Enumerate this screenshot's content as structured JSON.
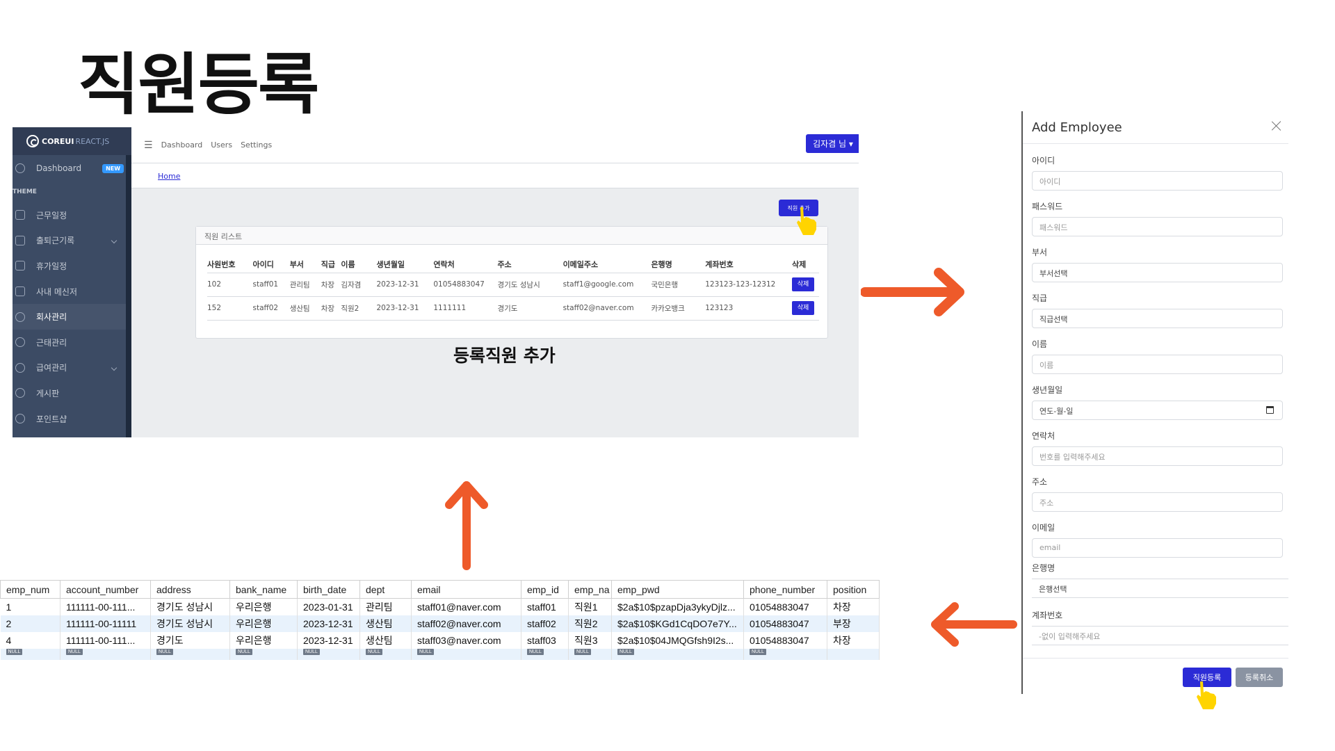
{
  "slide_title": "직원등록",
  "caption": "등록직원 추가",
  "sidebar": {
    "brand_name": "COREUI",
    "brand_suffix": "REACT.JS",
    "dashboard_label": "Dashboard",
    "dashboard_badge": "NEW",
    "section_title": "THEME",
    "items": [
      {
        "label": "근무일정"
      },
      {
        "label": "출퇴근기록"
      },
      {
        "label": "휴가일정"
      },
      {
        "label": "사내 메신저"
      },
      {
        "label": "회사관리"
      },
      {
        "label": "근태관리"
      },
      {
        "label": "급여관리"
      },
      {
        "label": "게시판"
      },
      {
        "label": "포인트샵"
      }
    ]
  },
  "header": {
    "links": [
      "Dashboard",
      "Users",
      "Settings"
    ],
    "user_button": "김자겸 님 ▾",
    "breadcrumb": "Home",
    "add_button": "직원 추가"
  },
  "employee_card": {
    "title": "직원 리스트",
    "columns": [
      "사원번호",
      "아이디",
      "부서",
      "직급",
      "이름",
      "생년월일",
      "연락처",
      "주소",
      "이메일주소",
      "은행명",
      "계좌번호",
      "삭제"
    ],
    "rows": [
      [
        "102",
        "staff01",
        "관리팀",
        "차장",
        "김자겸",
        "2023-12-31",
        "01054883047",
        "경기도 성남시",
        "staff1@google.com",
        "국민은행",
        "123123-123-12312"
      ],
      [
        "152",
        "staff02",
        "생산팀",
        "차장",
        "직원2",
        "2023-12-31",
        "1111111",
        "경기도",
        "staff02@naver.com",
        "카카오뱅크",
        "123123"
      ]
    ],
    "delete_label": "삭제"
  },
  "modal": {
    "title": "Add Employee",
    "fields": [
      {
        "label": "아이디",
        "placeholder": "아이디"
      },
      {
        "label": "패스워드",
        "placeholder": "패스워드"
      },
      {
        "label": "부서",
        "value": "부서선택"
      },
      {
        "label": "직급",
        "value": "직급선택"
      },
      {
        "label": "이름",
        "placeholder": "이름"
      },
      {
        "label": "생년월일",
        "value": "연도-월-일"
      },
      {
        "label": "연락처",
        "placeholder": "번호를 입력해주세요"
      },
      {
        "label": "주소",
        "placeholder": "주소"
      },
      {
        "label": "이메일",
        "placeholder": "email"
      },
      {
        "label": "은행명",
        "value": "은행선택"
      },
      {
        "label": "계좌번호",
        "placeholder": "-없이 입력해주세요"
      }
    ],
    "submit_label": "직원등록",
    "cancel_label": "등록취소"
  },
  "db_grid": {
    "columns": [
      "emp_num",
      "account_number",
      "address",
      "bank_name",
      "birth_date",
      "dept",
      "email",
      "emp_id",
      "emp_na",
      "emp_pwd",
      "phone_number",
      "position"
    ],
    "rows": [
      [
        "1",
        "111111-00-111...",
        "경기도 성남시",
        "우리은행",
        "2023-01-31",
        "관리팀",
        "staff01@naver.com",
        "staff01",
        "직원1",
        "$2a$10$pzapDja3ykyDjlz...",
        "01054883047",
        "차장"
      ],
      [
        "2",
        "111111-00-11111",
        "경기도 성남시",
        "우리은행",
        "2023-12-31",
        "생산팀",
        "staff02@naver.com",
        "staff02",
        "직원2",
        "$2a$10$KGd1CqDO7e7Y...",
        "01054883047",
        "부장"
      ],
      [
        "4",
        "111111-00-111...",
        "경기도",
        "우리은행",
        "2023-12-31",
        "생산팀",
        "staff03@naver.com",
        "staff03",
        "직원3",
        "$2a$10$04JMQGfsh9I2s...",
        "01054883047",
        "차장"
      ]
    ],
    "null_label": "NULL"
  },
  "colors": {
    "primary": "#2b2bd6",
    "sidebar": "#3c4b64",
    "arrow": "#ee5a2a",
    "cursor": "#ffd400"
  }
}
